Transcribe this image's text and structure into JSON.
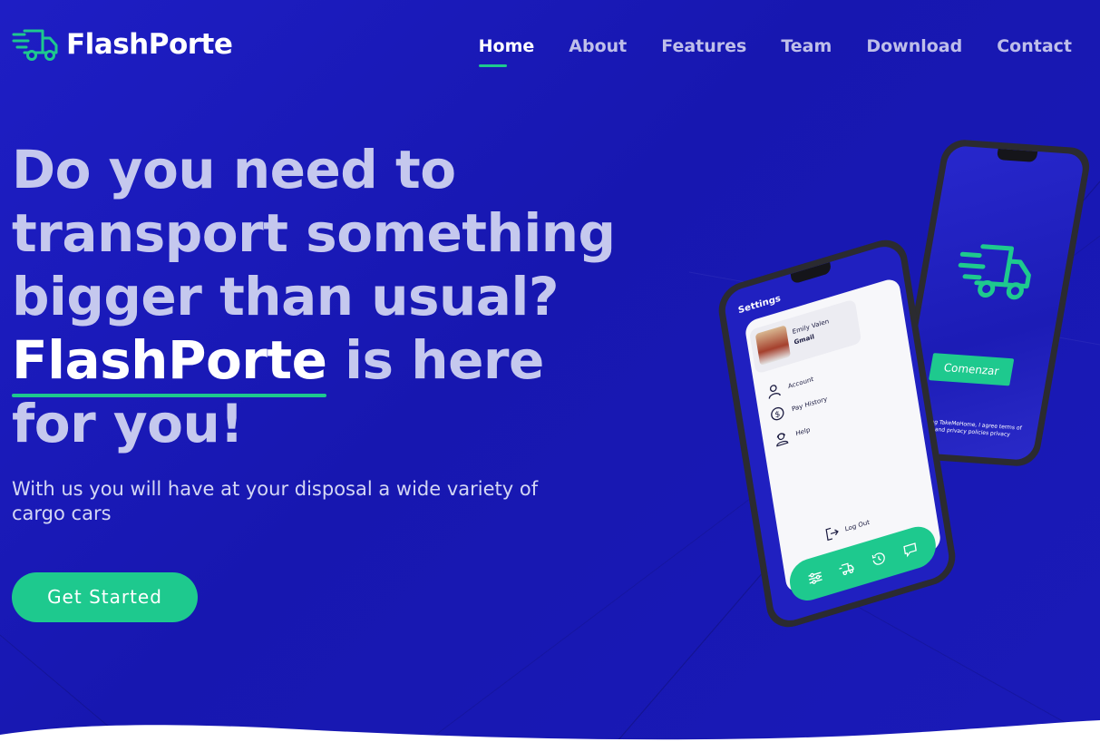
{
  "brand": {
    "name": "FlashPorte",
    "logo_icon": "truck-icon",
    "accent_color": "#1ec98e",
    "background_color": "#1a1ab8"
  },
  "nav": {
    "items": [
      {
        "label": "Home",
        "active": true
      },
      {
        "label": "About",
        "active": false
      },
      {
        "label": "Features",
        "active": false
      },
      {
        "label": "Team",
        "active": false
      },
      {
        "label": "Download",
        "active": false
      },
      {
        "label": "Contact",
        "active": false
      }
    ]
  },
  "hero": {
    "headline_line1": "Do you need to",
    "headline_line2": "transport something",
    "headline_line3": "bigger than usual?",
    "headline_brand": "FlashPorte",
    "headline_after_brand": " is here",
    "headline_line5": "for you!",
    "subtitle": "With us you will have at your disposal a wide variety of cargo cars",
    "cta_label": "Get Started"
  },
  "phone_back": {
    "button_label": "Comenzar",
    "terms_text": "By using TakeMeHome, I agree terms of use and privacy policies privacy"
  },
  "phone_front": {
    "title": "Settings",
    "profile_name": "Emily Valen",
    "profile_email": "Gmail",
    "menu": [
      {
        "label": "Account",
        "icon": "user-icon"
      },
      {
        "label": "Pay History",
        "icon": "dollar-icon"
      },
      {
        "label": "Help",
        "icon": "support-agent-icon"
      }
    ],
    "logout_label": "Log Out",
    "bottom_icons": [
      "sliders-icon",
      "truck-icon",
      "history-icon",
      "chat-icon"
    ]
  }
}
